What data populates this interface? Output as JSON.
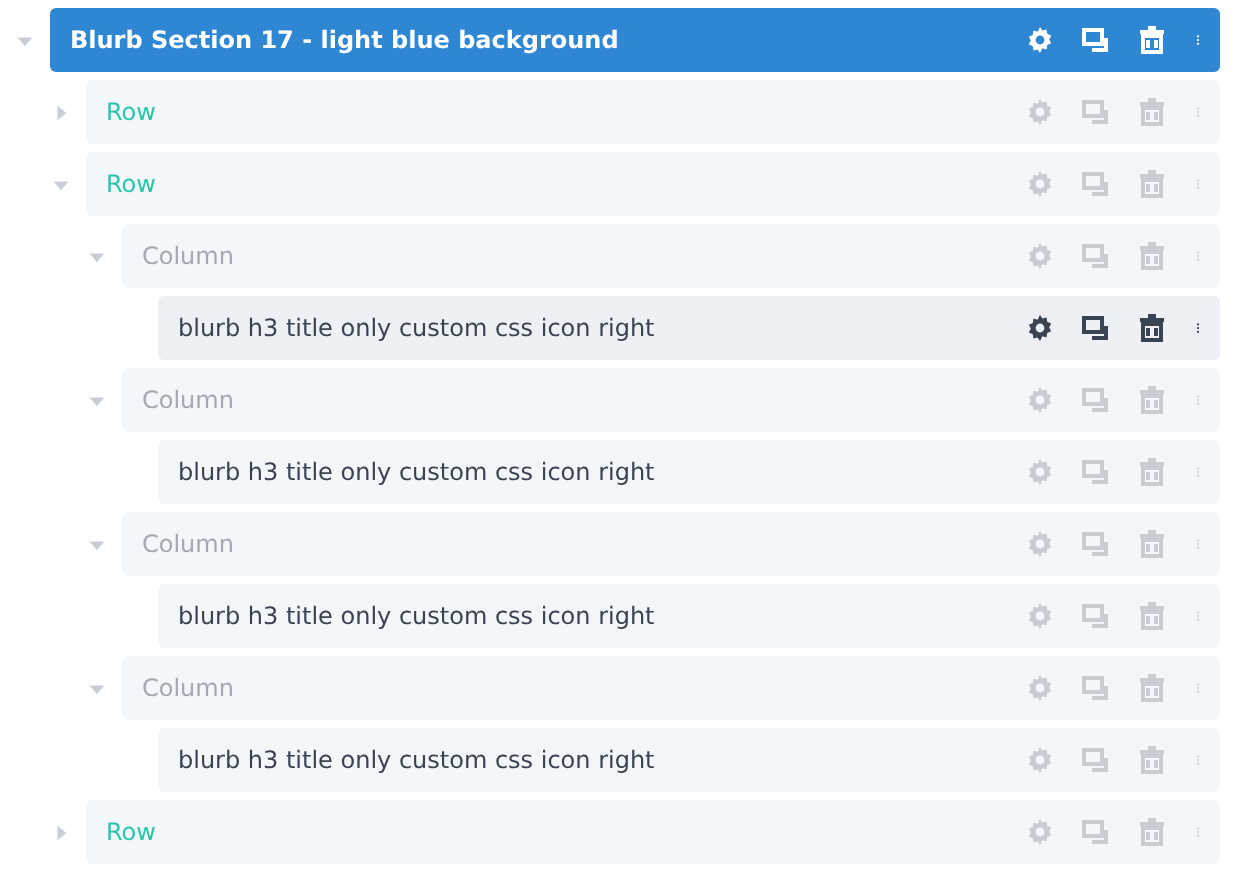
{
  "layers": [
    {
      "kind": "section",
      "label": "Blurb Section 17 - light blue background",
      "expanded": true,
      "highlighted": false,
      "children": [
        {
          "kind": "row",
          "label": "Row",
          "expanded": false,
          "highlighted": false
        },
        {
          "kind": "row",
          "label": "Row",
          "expanded": true,
          "highlighted": false,
          "children": [
            {
              "kind": "column",
              "label": "Column",
              "expanded": true,
              "highlighted": false,
              "children": [
                {
                  "kind": "module",
                  "label": "blurb h3 title only custom css icon right",
                  "highlighted": true
                }
              ]
            },
            {
              "kind": "column",
              "label": "Column",
              "expanded": true,
              "highlighted": false,
              "children": [
                {
                  "kind": "module",
                  "label": "blurb h3 title only custom css icon right",
                  "highlighted": false
                }
              ]
            },
            {
              "kind": "column",
              "label": "Column",
              "expanded": true,
              "highlighted": false,
              "children": [
                {
                  "kind": "module",
                  "label": "blurb h3 title only custom css icon right",
                  "highlighted": false
                }
              ]
            },
            {
              "kind": "column",
              "label": "Column",
              "expanded": true,
              "highlighted": false,
              "children": [
                {
                  "kind": "module",
                  "label": "blurb h3 title only custom css icon right",
                  "highlighted": false
                }
              ]
            }
          ]
        },
        {
          "kind": "row",
          "label": "Row",
          "expanded": false,
          "highlighted": false
        }
      ]
    }
  ]
}
